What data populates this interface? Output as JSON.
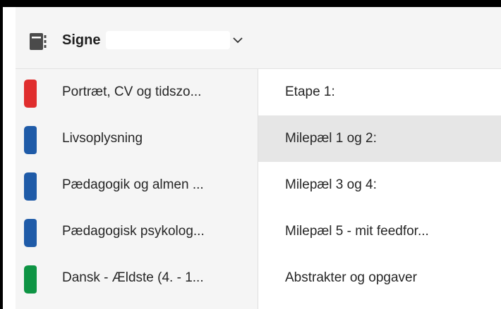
{
  "notebook": {
    "icon": "notebook-icon",
    "name": "Signe",
    "dropdown_icon": "chevron-down-icon"
  },
  "sections": [
    {
      "label": "Portræt, CV og tidszo...",
      "color": "#E02E2E"
    },
    {
      "label": "Livsoplysning",
      "color": "#1F5BA8"
    },
    {
      "label": "Pædagogik og almen ...",
      "color": "#1F5BA8"
    },
    {
      "label": "Pædagogisk psykolog...",
      "color": "#1F5BA8"
    },
    {
      "label": "Dansk - Ældste (4. - 1...",
      "color": "#0E9444"
    }
  ],
  "pages": [
    {
      "label": "Etape 1:",
      "selected": false
    },
    {
      "label": "Milepæl 1 og 2:",
      "selected": true
    },
    {
      "label": "Milepæl 3 og 4:",
      "selected": false
    },
    {
      "label": "Milepæl 5 - mit feedfor...",
      "selected": false
    },
    {
      "label": "Abstrakter og opgaver",
      "selected": false
    }
  ],
  "colors": {
    "background": "#000000",
    "pane_bg": "#F5F5F5",
    "selected_page_bg": "#E6E6E6"
  }
}
